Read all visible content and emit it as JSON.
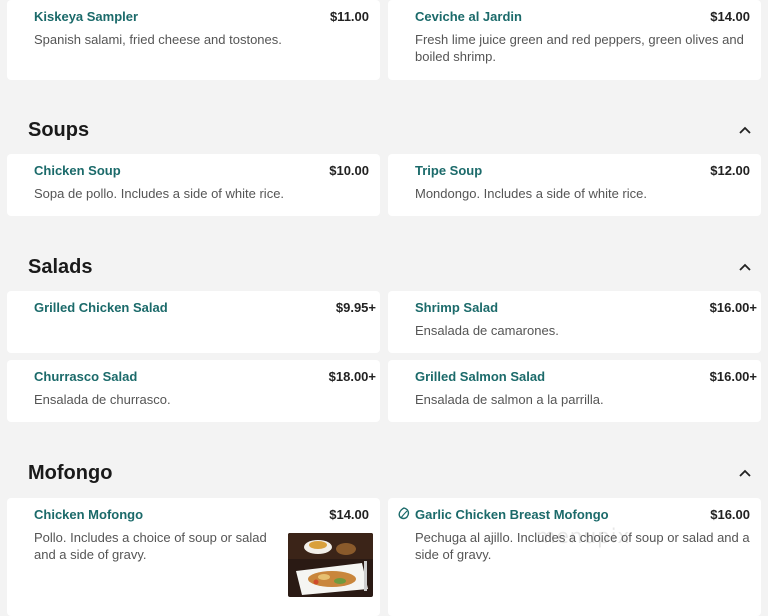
{
  "top_items": [
    {
      "name": "Kiskeya Sampler",
      "price": "$11.00",
      "desc": "Spanish salami, fried cheese and tostones."
    },
    {
      "name": "Ceviche al Jardin",
      "price": "$14.00",
      "desc": "Fresh lime juice green and red peppers, green olives and boiled shrimp."
    }
  ],
  "sections": {
    "soups": {
      "title": "Soups",
      "items": [
        {
          "name": "Chicken Soup",
          "price": "$10.00",
          "desc": "Sopa de pollo. Includes a side of white rice."
        },
        {
          "name": "Tripe Soup",
          "price": "$12.00",
          "desc": "Mondongo. Includes a side of white rice."
        }
      ]
    },
    "salads": {
      "title": "Salads",
      "items": [
        {
          "name": "Grilled Chicken Salad",
          "price": "$9.95+",
          "desc": ""
        },
        {
          "name": "Shrimp Salad",
          "price": "$16.00+",
          "desc": "Ensalada de camarones."
        },
        {
          "name": "Churrasco Salad",
          "price": "$18.00+",
          "desc": "Ensalada de churrasco."
        },
        {
          "name": "Grilled Salmon Salad",
          "price": "$16.00+",
          "desc": "Ensalada de salmon a la parrilla."
        }
      ]
    },
    "mofongo": {
      "title": "Mofongo",
      "items": [
        {
          "name": "Chicken Mofongo",
          "price": "$14.00",
          "desc": "Pollo. Includes a choice of soup or salad and a side of gravy."
        },
        {
          "name": "Garlic Chicken Breast Mofongo",
          "price": "$16.00",
          "desc": "Pechuga al ajillo. Includes a choice of soup or salad and a side of gravy."
        }
      ]
    }
  },
  "watermark": "menupix",
  "colors": {
    "item_name": "#1b6a6a",
    "background": "#f3f3f3",
    "card": "#ffffff"
  },
  "icons": {
    "section_toggle": "chevron-up-icon",
    "dietary": "leaf-icon"
  }
}
